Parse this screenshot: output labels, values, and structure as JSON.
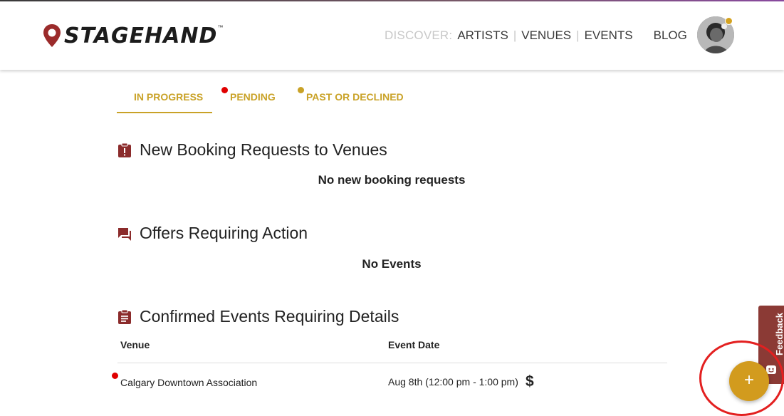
{
  "brand": {
    "name": "STAGEHAND",
    "trademark": "™",
    "accent": "#c9a227",
    "logo_pin_color": "#9b2b2b"
  },
  "nav": {
    "discover_label": "DISCOVER:",
    "items": [
      {
        "label": "ARTISTS"
      },
      {
        "label": "VENUES"
      },
      {
        "label": "EVENTS"
      }
    ],
    "separator": "|",
    "blog_label": "BLOG"
  },
  "user": {
    "avatar_icon": "user-avatar",
    "notification_color": "#d4a21f"
  },
  "tabs": [
    {
      "label": "IN PROGRESS",
      "active": true,
      "dot": null
    },
    {
      "label": "PENDING",
      "active": false,
      "dot": "#e00000"
    },
    {
      "label": "PAST OR DECLINED",
      "active": false,
      "dot": "#c9a227"
    }
  ],
  "sections": [
    {
      "title": "New Booking Requests to Venues",
      "icon": "alert-clipboard-icon",
      "empty_message": "No new booking requests"
    },
    {
      "title": "Offers Requiring Action",
      "icon": "chat-bubbles-icon",
      "empty_message": "No Events"
    },
    {
      "title": "Confirmed Events Requiring Details",
      "icon": "clipboard-list-icon"
    }
  ],
  "table": {
    "headers": [
      "Venue",
      "Event Date"
    ],
    "rows": [
      {
        "venue": "Calgary Downtown Association",
        "date": "Aug 8th (12:00 pm - 1:00 pm)",
        "dollar": "$",
        "unread": true
      }
    ]
  },
  "feedback": {
    "label": "Feedback",
    "icon": "smiley-icon",
    "color": "#8b3a35"
  },
  "fab": {
    "symbol": "+",
    "icon": "plus-icon",
    "color": "#d29b1e"
  }
}
